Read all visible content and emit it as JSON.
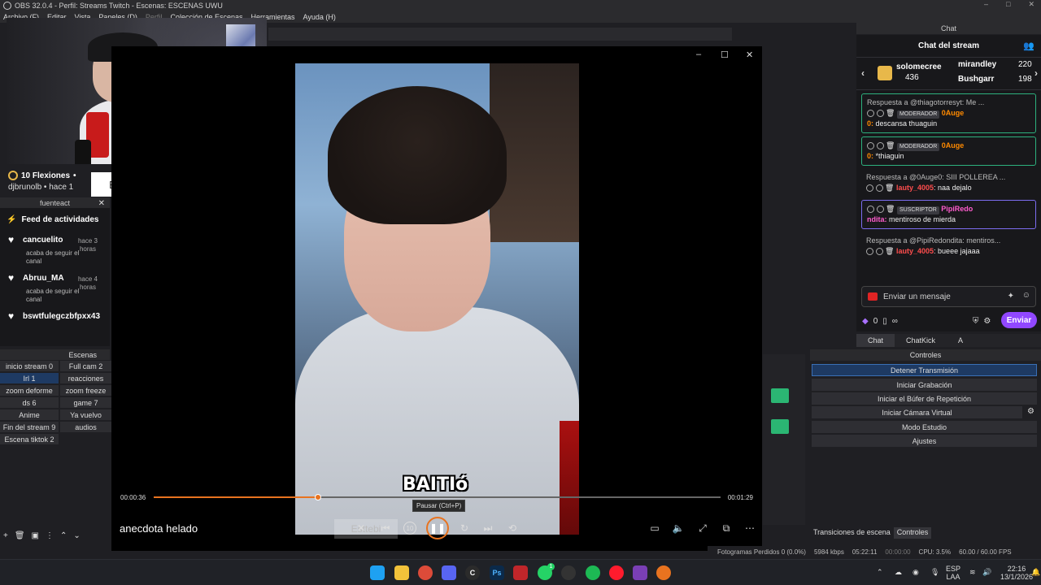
{
  "obs": {
    "title": "OBS 32.0.4 - Perfil: Streams Twitch - Escenas: ESCENAS UWU",
    "menu": [
      "Archivo (F)",
      "Editar",
      "Vista",
      "Paneles (D)",
      "Perfil",
      "Colección de Escenas",
      "Herramientas",
      "Ayuda (H)"
    ]
  },
  "goal": {
    "title": "10 Flexiones",
    "user": "djbrunolb",
    "time": "hace 1"
  },
  "tiktok_overlay": "Esttebi",
  "feed_dock": {
    "title": "fuenteact"
  },
  "feed": {
    "title": "Feed de actividades",
    "items": [
      {
        "name": "cancuelito",
        "time": "hace 3 horas",
        "desc": "acaba de seguir el canal"
      },
      {
        "name": "Abruu_MA",
        "time": "hace 4 horas",
        "desc": "acaba de seguir el canal"
      },
      {
        "name": "bswtfulegczbfpxx43",
        "time": "",
        "desc": ""
      }
    ]
  },
  "scenes": {
    "title": "Escenas",
    "items": [
      "inicio stream 0",
      "Full cam 2",
      "Irl 1",
      "reacciones",
      "zoom deforme",
      "zoom freeze",
      "ds 6",
      "game 7",
      "Anime",
      "Ya vuelvo",
      "Fin del stream 9",
      "audios",
      "Escena tiktok 2"
    ],
    "active_index": 2
  },
  "player": {
    "caption": "BAITIó",
    "current_time": "00:00:36",
    "total_time": "00:01:29",
    "progress": 0.29,
    "tooltip": "Pausar (Ctrl+P)",
    "track_title": "anecdota helado",
    "ghost_label": "Esttebi",
    "skip_label": "10"
  },
  "chat": {
    "dock_title": "Chat",
    "title": "Chat del stream",
    "gifters": [
      {
        "name": "solomecree",
        "count": "436"
      },
      {
        "name": "mirandley",
        "count": "220"
      },
      {
        "name": "Bushgarr",
        "count": "198"
      }
    ],
    "messages": [
      {
        "reply": "Respuesta a @thiagotorresyt: Me ...",
        "badge": "MODERADOR",
        "user": "0Auge0",
        "user_a": "0Auge",
        "user_b": "0:",
        "text": "descansa thuaguin"
      },
      {
        "reply": "",
        "badge": "MODERADOR",
        "user": "0Auge0",
        "user_a": "0Auge",
        "user_b": "0:",
        "text": "*thiaguin"
      },
      {
        "reply": "Respuesta a @0Auge0: SIII POLLEREA ...",
        "badge": "",
        "user": "lauty_4005",
        "text": "naa dejalo"
      },
      {
        "reply": "",
        "badge": "SUSCRIPTOR",
        "user": "PipiRedondita",
        "user_a": "PipiRedo",
        "user_b": "ndita:",
        "text": "mentiroso de mierda"
      },
      {
        "reply": "Respuesta a @PipiRedondita: mentiros...",
        "badge": "",
        "user": "lauty_4005",
        "text": "bueee jajaaa"
      }
    ],
    "input_placeholder": "Enviar un mensaje",
    "points": "0",
    "infinity": "∞",
    "send_label": "Enviar",
    "tabs": [
      "Chat",
      "ChatKick",
      "A"
    ]
  },
  "controls": {
    "title": "Controles",
    "buttons": [
      "Detener Transmisión",
      "Iniciar Grabación",
      "Iniciar el Búfer de Repetición",
      "Iniciar Cámara Virtual",
      "Modo Estudio",
      "Ajustes"
    ],
    "tabs": [
      "Transiciones de escena",
      "Controles"
    ]
  },
  "status": {
    "dropped": "Fotogramas Perdidos 0 (0.0%)",
    "bitrate": "5984 kbps",
    "live_time": "05:22:11",
    "rec_time": "00:00:00",
    "cpu": "CPU: 3.5%",
    "fps": "60.00 / 60.00 FPS"
  },
  "taskbar": {
    "lang": "ESP",
    "lang2": "LAA",
    "time": "22:16",
    "date": "13/1/2026",
    "whatsapp_badge": "1"
  }
}
